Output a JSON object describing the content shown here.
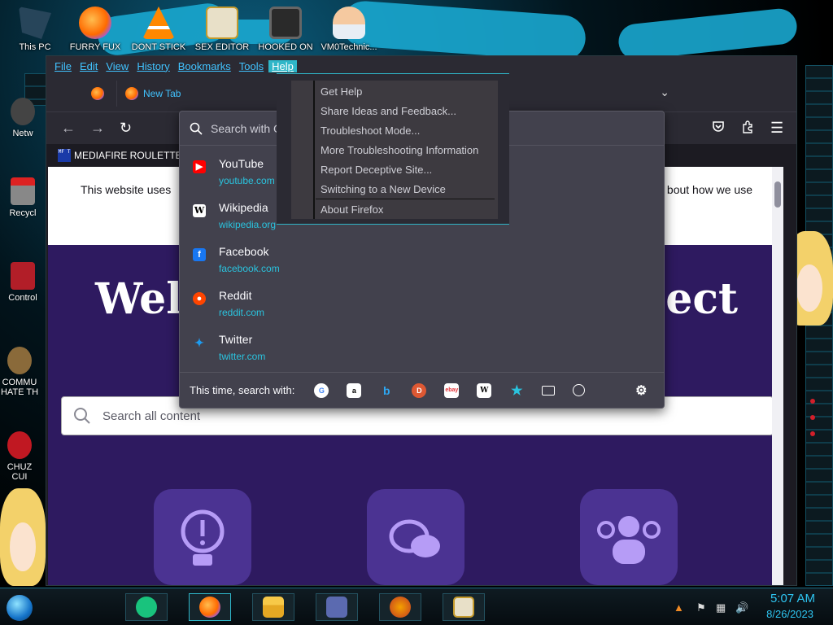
{
  "desktop": {
    "top_icons": [
      {
        "label": "This PC"
      },
      {
        "label": "FURRY FUX"
      },
      {
        "label": "DONT STICK"
      },
      {
        "label": "SEX EDITOR"
      },
      {
        "label": "HOOKED ON"
      },
      {
        "label": "VM0Technic..."
      }
    ],
    "side_icons": [
      {
        "label": "Netw"
      },
      {
        "label": "Recycl"
      },
      {
        "label": "Control"
      },
      {
        "label": "COMMU HATE TH"
      },
      {
        "label": "CHUZ CUI"
      }
    ]
  },
  "browser": {
    "menu": [
      "File",
      "Edit",
      "View",
      "History",
      "Bookmarks",
      "Tools",
      "Help"
    ],
    "active_menu": "Help",
    "tab_title": "New Tab",
    "bookmark": {
      "icon_text": "MF T",
      "label": "MEDIAFIRE ROULETTER"
    },
    "page": {
      "cookie_left": "This website uses",
      "cookie_right": "bout how we use",
      "heading_left": "Welc",
      "heading_right": "nect",
      "search_placeholder": "Search all content"
    }
  },
  "url_popup": {
    "placeholder": "Search with G",
    "suggestions": [
      {
        "title": "YouTube",
        "url": "youtube.com",
        "icon": "youtube-icon",
        "color": "#ff0000"
      },
      {
        "title": "Wikipedia",
        "url": "wikipedia.org",
        "icon": "wikipedia-icon",
        "color": "#ffffff"
      },
      {
        "title": "Facebook",
        "url": "facebook.com",
        "icon": "facebook-icon",
        "color": "#1877f2"
      },
      {
        "title": "Reddit",
        "url": "reddit.com",
        "icon": "reddit-icon",
        "color": "#ff4500"
      },
      {
        "title": "Twitter",
        "url": "twitter.com",
        "icon": "twitter-icon",
        "color": "#1d9bf0"
      }
    ],
    "search_with_label": "This time, search with:",
    "engines": [
      "google-icon",
      "amazon-icon",
      "bing-icon",
      "duckduckgo-icon",
      "ebay-icon",
      "wikipedia-icon",
      "bookmarks-star-icon",
      "tabs-icon",
      "history-icon"
    ]
  },
  "help_menu": {
    "items": [
      "Get Help",
      "Share Ideas and Feedback...",
      "Troubleshoot Mode...",
      "More Troubleshooting Information",
      "Report Deceptive Site...",
      "Switching to a New Device",
      "About Firefox"
    ]
  },
  "taskbar": {
    "time": "5:07 AM",
    "date": "8/26/2023"
  },
  "colors": {
    "accent": "#2fb6c8",
    "link": "#41c3ff",
    "page_bg": "#2e1a60"
  }
}
